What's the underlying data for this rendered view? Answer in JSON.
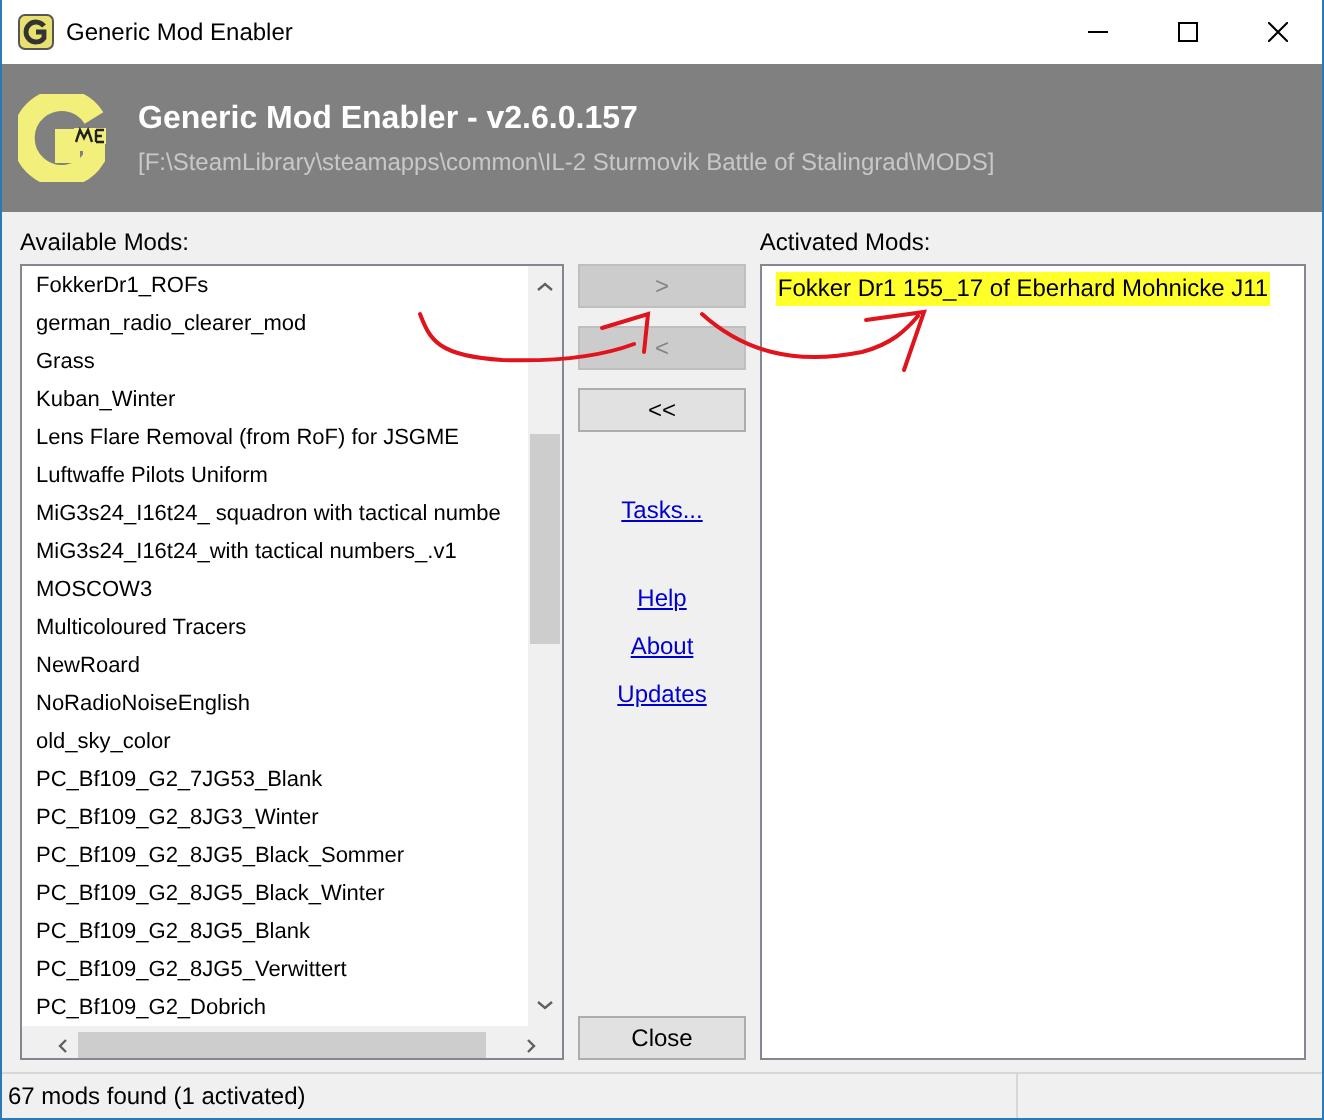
{
  "window": {
    "title": "Generic Mod Enabler"
  },
  "header": {
    "title": "Generic Mod Enabler - v2.6.0.157",
    "path": "[F:\\SteamLibrary\\steamapps\\common\\IL-2 Sturmovik Battle of Stalingrad\\MODS]"
  },
  "available": {
    "label": "Available Mods:",
    "items": [
      "FokkerDr1_ROFs",
      "german_radio_clearer_mod",
      "Grass",
      "Kuban_Winter",
      "Lens Flare Removal (from RoF) for JSGME",
      "Luftwaffe Pilots Uniform",
      "MiG3s24_I16t24_ squadron with tactical numbe",
      "MiG3s24_I16t24_with tactical numbers_.v1",
      "MOSCOW3",
      "Multicoloured Tracers",
      "NewRoard",
      "NoRadioNoiseEnglish",
      "old_sky_color",
      "PC_Bf109_G2_7JG53_Blank",
      "PC_Bf109_G2_8JG3_Winter",
      "PC_Bf109_G2_8JG5_Black_Sommer",
      "PC_Bf109_G2_8JG5_Black_Winter",
      "PC_Bf109_G2_8JG5_Blank",
      "PC_Bf109_G2_8JG5_Verwittert",
      "PC_Bf109_G2_Dobrich"
    ]
  },
  "buttons": [
    {
      "label": ">",
      "disabled": true
    },
    {
      "label": "<",
      "disabled": true
    },
    {
      "label": "<<",
      "disabled": false
    }
  ],
  "links": [
    {
      "label": "Tasks..."
    },
    {
      "label": "Help"
    },
    {
      "label": "About"
    },
    {
      "label": "Updates"
    }
  ],
  "close": {
    "label": "Close"
  },
  "activated": {
    "label": "Activated Mods:",
    "items": [
      {
        "text": "Fokker Dr1 155_17 of Eberhard Mohnicke J11",
        "highlighted": true
      }
    ]
  },
  "status_bar": {
    "text": "67 mods found (1 activated)"
  }
}
